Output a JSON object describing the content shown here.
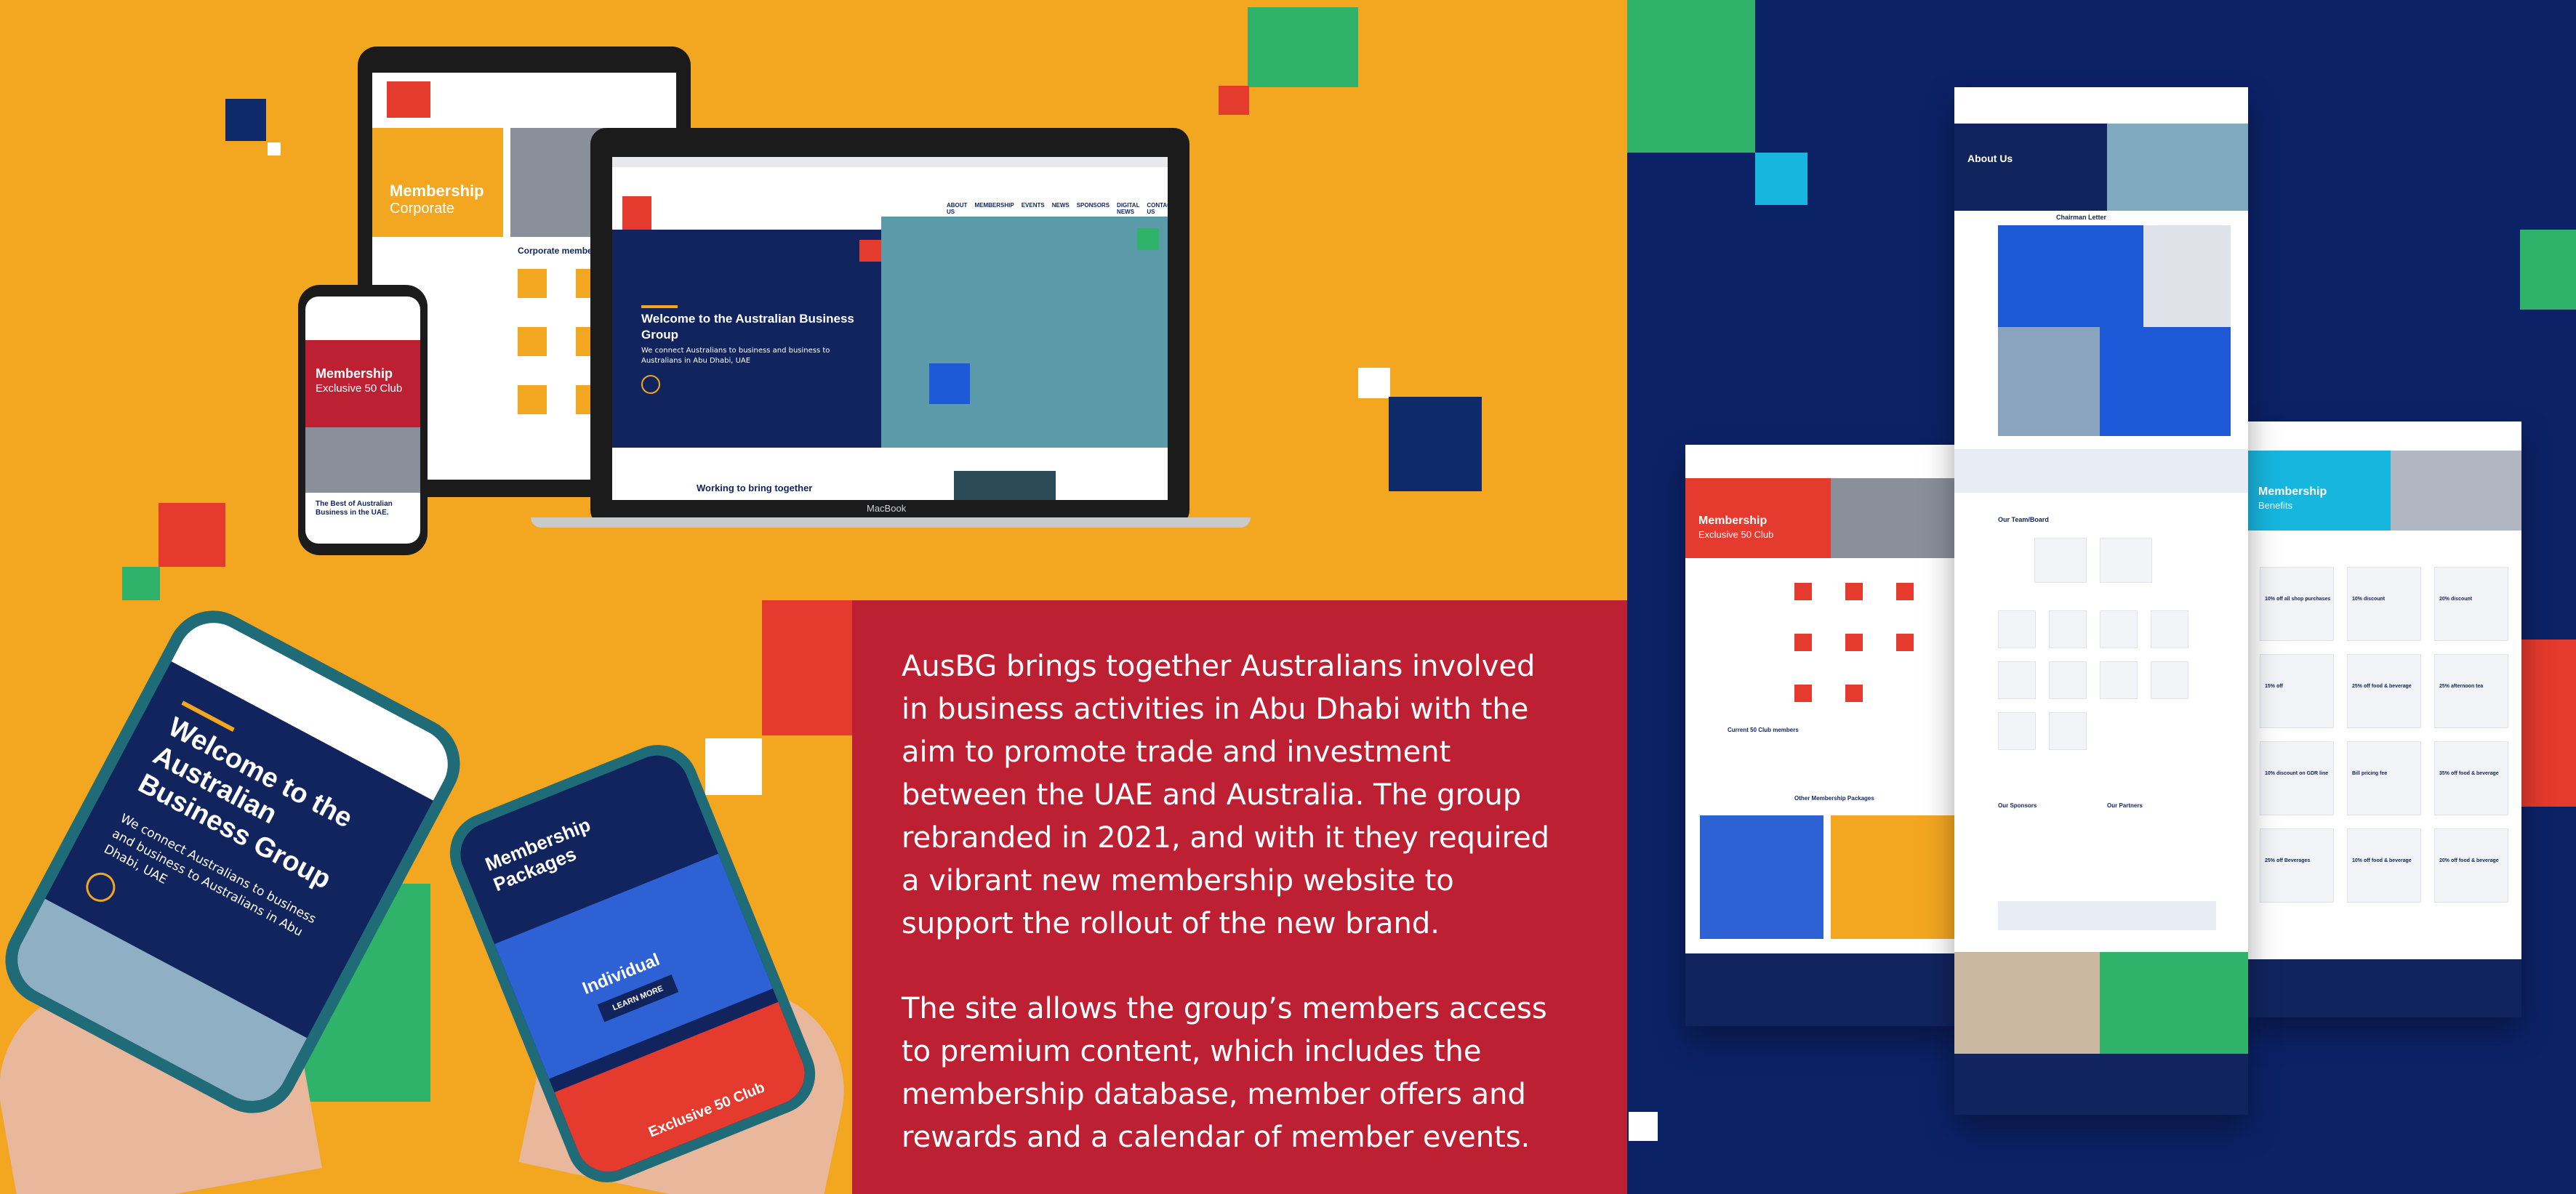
{
  "description": {
    "paragraph1": "AusBG brings together Australians involved in business activities in Abu Dhabi with the aim to promote trade and investment between the UAE and Australia. The group rebranded in 2021, and with it they required a vibrant new membership website to support the rollout of the new brand.",
    "paragraph2": "The site allows the group’s members access to premium content, which includes the membership database, member offers and rewards and a calendar of member events."
  },
  "laptop": {
    "hero_title": "Welcome to the Australian Business Group",
    "hero_sub": "We connect Australians to business and business to Australians in Abu Dhabi, UAE",
    "section_title": "Working to bring together",
    "brand": "MacBook",
    "nav": [
      "ABOUT US",
      "MEMBERSHIP",
      "EVENTS",
      "NEWS",
      "SPONSORS",
      "DIGITAL NEWS",
      "CONTACT US"
    ]
  },
  "tablet": {
    "hero_title": "Membership",
    "hero_sub": "Corporate",
    "section_title": "Corporate member benefits in"
  },
  "phone_small": {
    "hero_title": "Membership",
    "hero_sub": "Exclusive 50 Club",
    "footer_title": "The Best of Australian Business in the UAE."
  },
  "phone_left": {
    "hero_title": "Welcome to the Australian Business Group",
    "hero_sub": "We connect Australians to business and business to Australians in Abu Dhabi, UAE"
  },
  "phone_right": {
    "hero_title": "Membership Packages",
    "card_label": "Individual",
    "card_button": "LEARN MORE",
    "footer_label": "Exclusive 50 Club"
  },
  "pages": {
    "left_title": "Membership",
    "left_sub": "Exclusive 50 Club",
    "left_members": "Current 50 Club members",
    "left_packages": "Other Membership Packages",
    "center_title": "About Us",
    "center_chair": "Chairman Letter",
    "center_team": "Our Team/Board",
    "center_sponsors": "Our Sponsors",
    "center_partners": "Our Partners",
    "right_title": "Membership",
    "right_sub": "Benefits",
    "right_offers": [
      "10% off all shop purchases",
      "10% discount",
      "20% discount",
      "15% off",
      "25% off food & beverage",
      "25% afternoon tea",
      "10% discount on GDR line",
      "Bill pricing fee",
      "35% off food & beverage",
      "25% off Beverages",
      "10% off food & beverage",
      "20% off food & beverage"
    ]
  }
}
